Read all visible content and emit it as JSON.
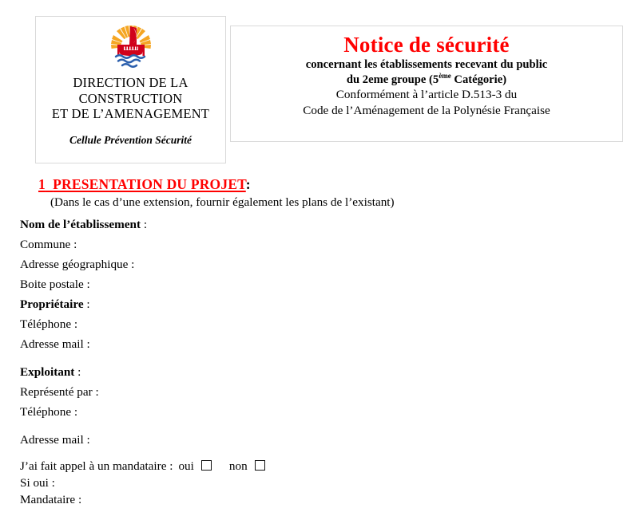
{
  "document": {
    "kind": "notice-de-securite-form"
  },
  "header": {
    "logo": {
      "name": "french-polynesia-coat-of-arms",
      "colors": {
        "sun": "#F5A623",
        "sail": "#D0021B",
        "hull": "#D0021B",
        "waves": "#2B5FAD",
        "sail_moon": "#FFFFFF"
      }
    },
    "org_line1": "DIRECTION DE LA",
    "org_line2": "CONSTRUCTION",
    "org_line3": "ET DE L’AMENAGEMENT",
    "org_subtitle": "Cellule Prévention Sécurité",
    "title": "Notice de sécurité",
    "title_color": "#FF0000",
    "subtitle_line1": "concernant les établissements recevant du public",
    "subtitle_line2_pre": "du 2eme groupe (5",
    "subtitle_line2_sup": "ème",
    "subtitle_line2_post": " Catégorie)",
    "subtitle_line3": "Conformément à l’article D.513-3 du",
    "subtitle_line4": "Code de l’Aménagement de la Polynésie Française"
  },
  "section": {
    "number": "1",
    "heading": "PRESENTATION DU PROJET",
    "heading_colon": ":",
    "heading_color": "#FF0000",
    "note": "(Dans le cas d’une extension, fournir également les plans de l’existant)"
  },
  "fields": [
    {
      "label": "Nom de l’établissement",
      "colon": ":",
      "bold": true,
      "value": ""
    },
    {
      "label": "Commune",
      "colon": ":",
      "bold": false,
      "value": ""
    },
    {
      "label": "Adresse géographique",
      "colon": ":",
      "bold": false,
      "value": ""
    },
    {
      "label": "Boite postale",
      "colon": ":",
      "bold": false,
      "value": ""
    },
    {
      "label": "Propriétaire",
      "colon": ":",
      "bold": true,
      "value": ""
    },
    {
      "label": "Téléphone",
      "colon": ":",
      "bold": false,
      "value": ""
    },
    {
      "label": "Adresse mail",
      "colon": ":",
      "bold": false,
      "value": ""
    },
    {
      "label": "Exploitant",
      "colon": ":",
      "bold": true,
      "value": ""
    },
    {
      "label": "Représenté par",
      "colon": ":",
      "bold": false,
      "value": ""
    },
    {
      "label": "Téléphone",
      "colon": ":",
      "bold": false,
      "value": ""
    },
    {
      "label": "Adresse mail",
      "colon": ":",
      "bold": false,
      "value": ""
    }
  ],
  "mandataire": {
    "question": "J’ai fait appel à un mandataire :",
    "option_yes": "oui",
    "option_no": "non",
    "yes_checked": false,
    "no_checked": false,
    "if_yes_label": "Si oui",
    "if_yes_colon": ":",
    "cut_off_label": "Mandataire",
    "cut_off_colon": ":"
  }
}
